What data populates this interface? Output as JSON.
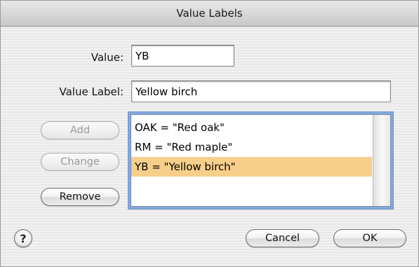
{
  "window": {
    "title": "Value Labels"
  },
  "form": {
    "value_label_text": "Value:",
    "value_input": "YB",
    "value_label_label_text": "Value Label:",
    "value_label_input": "Yellow birch"
  },
  "actions": {
    "add": "Add",
    "change": "Change",
    "remove": "Remove"
  },
  "list": {
    "items": [
      {
        "text": "OAK = \"Red oak\"",
        "selected": false
      },
      {
        "text": "RM = \"Red maple\"",
        "selected": false
      },
      {
        "text": "YB = \"Yellow birch\"",
        "selected": true
      }
    ]
  },
  "footer": {
    "help_glyph": "?",
    "cancel": "Cancel",
    "ok": "OK"
  },
  "colors": {
    "selection_highlight": "#f7cf8a",
    "focus_ring": "#86a9dc"
  }
}
